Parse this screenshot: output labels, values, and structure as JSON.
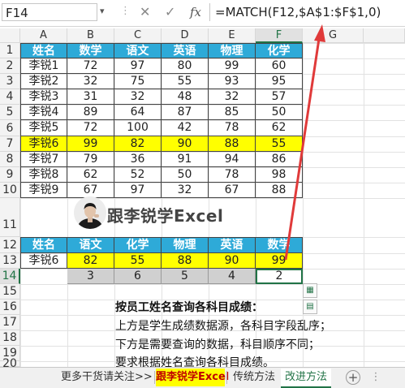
{
  "formula_bar": {
    "name_box": "F14",
    "name_arrow": "▾",
    "separator": "⋮",
    "cancel": "✕",
    "enter": "✓",
    "fx": "fx",
    "formula": "=MATCH(F12,$A$1:$F$1,0)"
  },
  "columns": [
    "A",
    "B",
    "C",
    "D",
    "E",
    "F",
    "G"
  ],
  "rows": [
    "1",
    "2",
    "3",
    "4",
    "5",
    "6",
    "7",
    "8",
    "9",
    "10",
    "11",
    "12",
    "13",
    "14",
    "15",
    "16",
    "17",
    "18",
    "19",
    "20"
  ],
  "table": {
    "headers": [
      "姓名",
      "数学",
      "语文",
      "英语",
      "物理",
      "化学"
    ],
    "rows": [
      [
        "李锐1",
        "72",
        "97",
        "80",
        "99",
        "60"
      ],
      [
        "李锐2",
        "32",
        "75",
        "55",
        "93",
        "95"
      ],
      [
        "李锐3",
        "31",
        "32",
        "48",
        "32",
        "57"
      ],
      [
        "李锐4",
        "89",
        "64",
        "87",
        "85",
        "50"
      ],
      [
        "李锐5",
        "72",
        "100",
        "42",
        "78",
        "62"
      ],
      [
        "李锐6",
        "99",
        "82",
        "90",
        "88",
        "55"
      ],
      [
        "李锐7",
        "79",
        "36",
        "91",
        "94",
        "86"
      ],
      [
        "李锐8",
        "62",
        "52",
        "50",
        "78",
        "98"
      ],
      [
        "李锐9",
        "67",
        "97",
        "32",
        "67",
        "88"
      ]
    ],
    "highlight_row": 5
  },
  "logo": {
    "text": "跟李锐学Excel"
  },
  "query": {
    "headers": [
      "姓名",
      "语文",
      "化学",
      "物理",
      "英语",
      "数学"
    ],
    "values": [
      "李锐6",
      "82",
      "55",
      "88",
      "90",
      "99"
    ],
    "match": [
      "3",
      "6",
      "5",
      "4",
      "2"
    ]
  },
  "notes": {
    "title": "按员工姓名查询各科目成绩：",
    "lines": [
      "上方是学生成绩数据源，各科目字段乱序；",
      "下方是需要查询的数据，科目顺序不同；",
      "要求根据姓名查询各科目成绩。"
    ]
  },
  "tabs": {
    "more": "更多干货请关注>>",
    "brand": "跟李锐学Excel",
    "traditional": "传统方法",
    "improved": "改进方法",
    "add": "+"
  },
  "colors": {
    "header_blue": "#2eaad8",
    "highlight_yellow": "#ffff00",
    "arrow_red": "#e03a3a",
    "excel_green": "#217346"
  }
}
